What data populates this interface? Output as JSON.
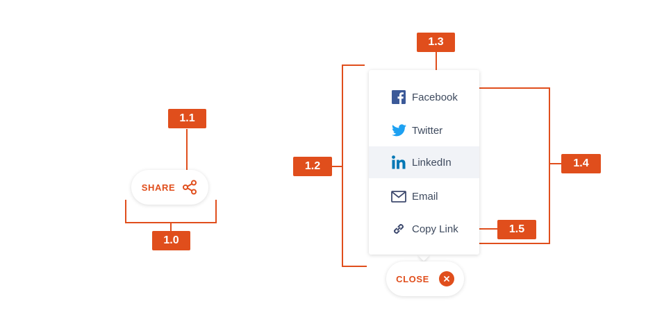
{
  "callouts": {
    "c10": "1.0",
    "c11": "1.1",
    "c12": "1.2",
    "c13": "1.3",
    "c14": "1.4",
    "c15": "1.5"
  },
  "share_button": {
    "label": "SHARE",
    "icon": "share-icon"
  },
  "close_button": {
    "label": "CLOSE",
    "icon": "close-icon"
  },
  "menu": {
    "items": [
      {
        "label": "Facebook",
        "icon": "facebook-icon"
      },
      {
        "label": "Twitter",
        "icon": "twitter-icon"
      },
      {
        "label": "LinkedIn",
        "icon": "linkedin-icon",
        "highlighted": true
      },
      {
        "label": "Email",
        "icon": "email-icon"
      },
      {
        "label": "Copy Link",
        "icon": "link-icon"
      }
    ]
  },
  "colors": {
    "accent": "#e04e1c",
    "facebook": "#3b5998",
    "twitter": "#1da1f2",
    "linkedin": "#0077b5",
    "icon_gray": "#3e4a6e",
    "hover_bg": "#f1f3f7"
  }
}
